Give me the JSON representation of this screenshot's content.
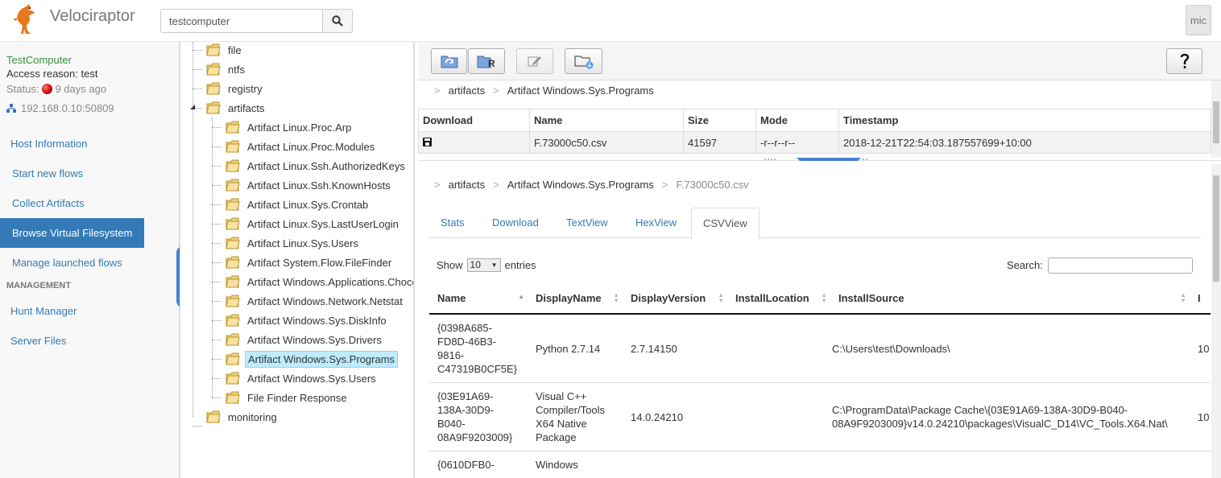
{
  "app": {
    "brand": "Velociraptor",
    "user": "mic"
  },
  "search": {
    "value": "testcomputer"
  },
  "client": {
    "name": "TestComputer",
    "access_reason": "Access reason: test",
    "status_label": "Status:",
    "status_time": "9 days ago",
    "ip": "192.168.0.10:50809"
  },
  "nav": {
    "items": [
      {
        "label": "Host Information"
      },
      {
        "label": "Start new flows"
      },
      {
        "label": "Collect Artifacts"
      },
      {
        "label": "Browse Virtual Filesystem"
      },
      {
        "label": "Manage launched flows"
      }
    ],
    "section": "MANAGEMENT",
    "mgmt_items": [
      {
        "label": "Hunt Manager"
      },
      {
        "label": "Server Files"
      }
    ]
  },
  "tree": {
    "top": [
      "file",
      "ntfs",
      "registry",
      "artifacts"
    ],
    "children": [
      "Artifact Linux.Proc.Arp",
      "Artifact Linux.Proc.Modules",
      "Artifact Linux.Ssh.AuthorizedKeys",
      "Artifact Linux.Ssh.KnownHosts",
      "Artifact Linux.Sys.Crontab",
      "Artifact Linux.Sys.LastUserLogin",
      "Artifact Linux.Sys.Users",
      "Artifact System.Flow.FileFinder",
      "Artifact Windows.Applications.Choco",
      "Artifact Windows.Network.Netstat",
      "Artifact Windows.Sys.DiskInfo",
      "Artifact Windows.Sys.Drivers",
      "Artifact Windows.Sys.Programs",
      "Artifact Windows.Sys.Users",
      "File Finder Response"
    ],
    "last": "monitoring"
  },
  "breadcrumb_top": {
    "seg1": "artifacts",
    "seg2": "Artifact Windows.Sys.Programs"
  },
  "files": {
    "headers": [
      "Download",
      "Name",
      "Size",
      "Mode",
      "Timestamp"
    ],
    "row": {
      "name": "F.73000c50.csv",
      "size": "41597",
      "mode": "-r--r--r--",
      "timestamp": "2018-12-21T22:54:03.187557699+10:00"
    }
  },
  "breadcrumb_bottom": {
    "seg1": "artifacts",
    "seg2": "Artifact Windows.Sys.Programs",
    "seg3": "F.73000c50.csv"
  },
  "tabs": [
    "Stats",
    "Download",
    "TextView",
    "HexView",
    "CSVView"
  ],
  "csv": {
    "show": "Show",
    "entries_value": "10",
    "entries": "entries",
    "search_label": "Search:",
    "headers": [
      "Name",
      "DisplayName",
      "DisplayVersion",
      "InstallLocation",
      "InstallSource",
      "I"
    ],
    "rows": [
      {
        "name_lines": [
          "{0398A685-",
          "FD8D-46B3-",
          "9816-",
          "C47319B0CF5E}"
        ],
        "display_lines": [
          "Python 2.7.14"
        ],
        "version": "2.7.14150",
        "location": "",
        "source_lines": [
          "C:\\Users\\test\\Downloads\\"
        ],
        "extra": "10"
      },
      {
        "name_lines": [
          "{03E91A69-",
          "138A-30D9-",
          "B040-",
          "08A9F9203009}"
        ],
        "display_lines": [
          "Visual C++",
          "Compiler/Tools",
          "X64 Native",
          "Package"
        ],
        "version": "14.0.24210",
        "location": "",
        "source_lines": [
          "C:\\ProgramData\\Package Cache\\{03E91A69-138A-30D9-B040-",
          "08A9F9203009}v14.0.24210\\packages\\VisualC_D14\\VC_Tools.X64.Nat\\"
        ],
        "extra": "10"
      },
      {
        "name_lines": [
          "{0610DFB0-"
        ],
        "display_lines": [
          "Windows"
        ],
        "version": "",
        "location": "",
        "source_lines": [
          ""
        ],
        "extra": ""
      }
    ]
  },
  "colors": {
    "accent": "#337ab7",
    "client_name": "#3c8f3c",
    "selected_node": "#beebff"
  }
}
